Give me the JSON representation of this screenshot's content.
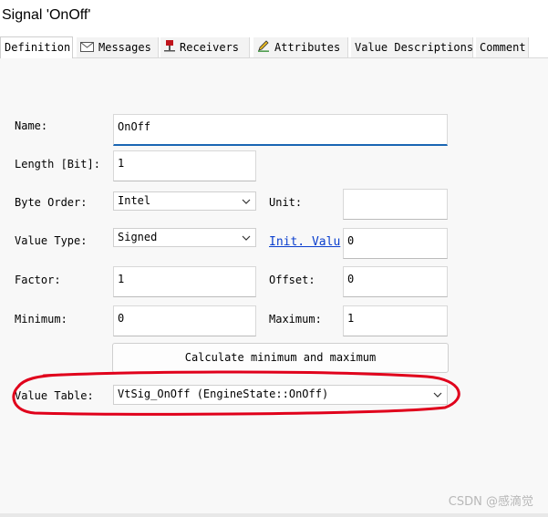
{
  "window": {
    "title": "Signal 'OnOff'"
  },
  "tabs": [
    {
      "label": "Definition",
      "icon": "none",
      "active": true
    },
    {
      "label": "Messages",
      "icon": "envelope-icon",
      "active": false
    },
    {
      "label": "Receivers",
      "icon": "pin-icon",
      "active": false
    },
    {
      "label": "Attributes",
      "icon": "pencil-icon",
      "active": false
    },
    {
      "label": "Value Descriptions",
      "icon": "none",
      "active": false
    },
    {
      "label": "Comment",
      "icon": "none",
      "active": false
    }
  ],
  "form": {
    "name": {
      "label": "Name:",
      "value": "OnOff"
    },
    "length": {
      "label": "Length [Bit]:",
      "value": "1"
    },
    "byte_order": {
      "label": "Byte Order:",
      "value": "Intel"
    },
    "unit": {
      "label": "Unit:",
      "value": ""
    },
    "value_type": {
      "label": "Value Type:",
      "value": "Signed"
    },
    "init_value": {
      "label": "Init. Valu",
      "value": "0"
    },
    "factor": {
      "label": "Factor:",
      "value": "1"
    },
    "offset": {
      "label": "Offset:",
      "value": "0"
    },
    "minimum": {
      "label": "Minimum:",
      "value": "0"
    },
    "maximum": {
      "label": "Maximum:",
      "value": "1"
    },
    "calc_button": "Calculate minimum and maximum",
    "value_table": {
      "label": "Value Table:",
      "value": "VtSig_OnOff (EngineState::OnOff)"
    }
  },
  "colors": {
    "link": "#0b3fce",
    "focus_underline": "#1a66b3",
    "annotation": "#e0001b"
  },
  "watermark": "CSDN @感滴觉"
}
